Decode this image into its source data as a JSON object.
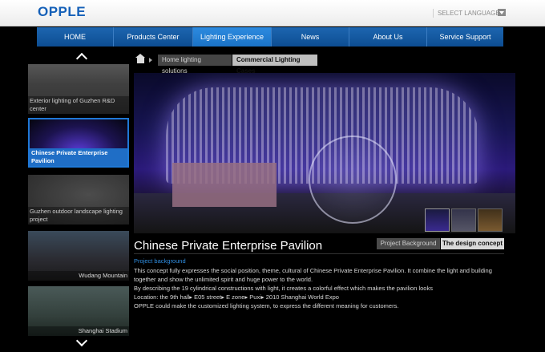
{
  "header": {
    "logo": "OPPLE",
    "language_label": "SELECT LANGUAGE"
  },
  "nav": {
    "items": [
      {
        "label": "HOME"
      },
      {
        "label": "Products Center"
      },
      {
        "label": "Lighting Experience"
      },
      {
        "label": "News"
      },
      {
        "label": "About Us"
      },
      {
        "label": "Service Support"
      }
    ],
    "active": "Lighting Experience"
  },
  "thumbnails": [
    {
      "caption": "Exterior lighting of Guzhen R&D center"
    },
    {
      "caption": "Chinese Private Enterprise Pavilion"
    },
    {
      "caption": "Guzhen outdoor landscape lighting project"
    },
    {
      "caption": "Wudang Mountain"
    },
    {
      "caption": "Shanghai Stadium"
    }
  ],
  "breadcrumb": {
    "items": [
      "Home lighting solutions",
      "Commercial Lighting Cases"
    ]
  },
  "detail": {
    "title": "Chinese Private Enterprise Pavilion",
    "tabs": [
      "Project Background",
      "The design concept"
    ],
    "subheading": "Project background",
    "paragraphs": [
      "This concept fully expresses the social position, theme, cultural of Chinese Private Enterprise Pavilion. It combine the light and building together and show the unlimited spirit and huge power to the world.",
      "By describing the 19 cylindrical constructions with light, it creates a colorful effect which makes the pavilion looks",
      "Location: the 9th hall▸ E05 street▸ E zone▸ Puxi▸ 2010 Shanghai World Expo",
      "OPPLE could make the customized lighting system, to express the different meaning for customers."
    ]
  },
  "colors": {
    "brand_blue": "#1560b8",
    "nav_active": "#1f78d6",
    "subheading": "#2f8de0"
  }
}
